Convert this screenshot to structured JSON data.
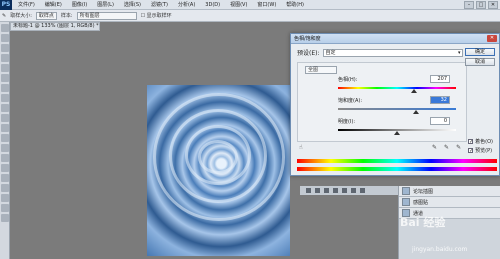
{
  "app": {
    "logo": "PS"
  },
  "menubar": {
    "items": [
      "文件(F)",
      "编辑(E)",
      "图像(I)",
      "图层(L)",
      "选择(S)",
      "滤镜(T)",
      "分析(A)",
      "3D(D)",
      "视图(V)",
      "窗口(W)",
      "帮助(H)"
    ],
    "controls": [
      "–",
      "□",
      "✕"
    ]
  },
  "optbar": {
    "size_label": "取样大小:",
    "size_value": "取样点",
    "sample_label": "样本:",
    "sample_value": "所有图层",
    "show_ring": "显示取样环"
  },
  "document": {
    "tab_title": "未标题-1 @ 133% (图层 1, RGB/8) *"
  },
  "dialog": {
    "title": "色相/饱和度",
    "preset_label": "预设(E):",
    "preset_value": "自定",
    "channel_value": "全图",
    "params": [
      {
        "label": "色相(H):",
        "value": "207",
        "selected": false,
        "thumb": 0.64
      },
      {
        "label": "饱和度(A):",
        "value": "32",
        "selected": true,
        "thumb": 0.66
      },
      {
        "label": "明度(I):",
        "value": "0",
        "selected": false,
        "thumb": 0.5
      }
    ],
    "buttons": {
      "ok": "确定",
      "cancel": "取消"
    },
    "colorize_label": "着色(O)",
    "preview_label": "预览(P)",
    "colorize_checked": true,
    "preview_checked": true
  },
  "layers": {
    "rows": [
      "论坛插图",
      "感图贴",
      "通道"
    ]
  },
  "watermark": {
    "text": "Bai 经验",
    "url": "jingyan.baidu.com"
  }
}
